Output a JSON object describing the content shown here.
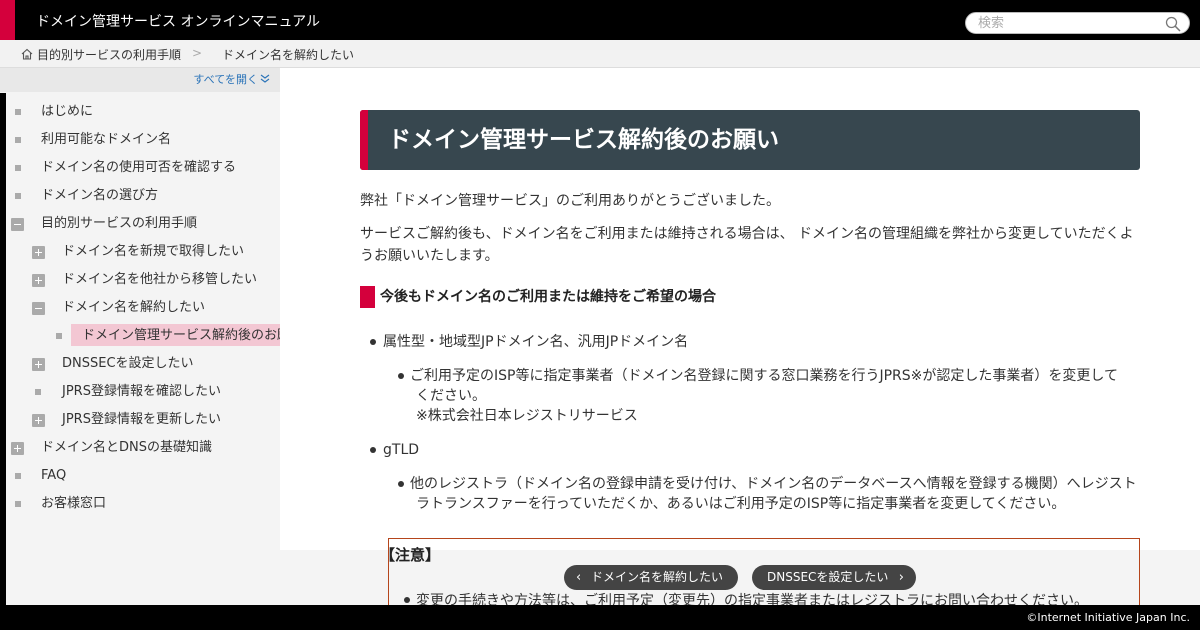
{
  "header": {
    "title": "ドメイン管理サービス オンラインマニュアル",
    "search_placeholder": "検索",
    "accent_color": "#d4003c"
  },
  "breadcrumb": {
    "items": [
      "目的別サービスの利用手順",
      "ドメイン名を解約したい"
    ],
    "separator": ">"
  },
  "sidebar": {
    "expand_all": "すべてを開く",
    "items": [
      {
        "label": "はじめに",
        "marker": "bullet"
      },
      {
        "label": "利用可能なドメイン名",
        "marker": "bullet"
      },
      {
        "label": "ドメイン名の使用可否を確認する",
        "marker": "bullet"
      },
      {
        "label": "ドメイン名の選び方",
        "marker": "bullet"
      },
      {
        "label": "目的別サービスの利用手順",
        "marker": "minus"
      },
      {
        "label": "ドメイン名を新規で取得したい",
        "marker": "plus"
      },
      {
        "label": "ドメイン名を他社から移管したい",
        "marker": "plus"
      },
      {
        "label": "ドメイン名を解約したい",
        "marker": "minus"
      },
      {
        "label": "ドメイン管理サービス解約後のお願い",
        "marker": "bullet",
        "active": true
      },
      {
        "label": "DNSSECを設定したい",
        "marker": "plus"
      },
      {
        "label": "JPRS登録情報を確認したい",
        "marker": "bullet"
      },
      {
        "label": "JPRS登録情報を更新したい",
        "marker": "plus"
      },
      {
        "label": "ドメイン名とDNSの基礎知識",
        "marker": "plus"
      },
      {
        "label": "FAQ",
        "marker": "bullet"
      },
      {
        "label": "お客様窓口",
        "marker": "bullet"
      }
    ]
  },
  "main": {
    "title": "ドメイン管理サービス解約後のお願い",
    "intro1": "弊社「ドメイン管理サービス」のご利用ありがとうございました。",
    "intro2_line1": "サービスご解約後も、ドメイン名をご利用または維持される場合は、 ドメイン名の管理組織を弊社から変更していただくよ",
    "intro2_line2": "うお願いいたします。",
    "section_heading": "今後もドメイン名のご利用または維持をご希望の場合",
    "list": [
      {
        "label": "属性型・地域型JPドメイン名、汎用JPドメイン名",
        "sub_lines": [
          "ご利用予定のISP等に指定事業者（ドメイン名登録に関する窓口業務を行うJPRS※が認定した事業者）を変更して",
          "ください。",
          "※株式会社日本レジストリサービス"
        ]
      },
      {
        "label": "gTLD",
        "sub_lines": [
          "他のレジストラ（ドメイン名の登録申請を受け付け、ドメイン名のデータベースへ情報を登録する機関）へレジスト",
          "ラトランスファーを行っていただくか、あるいはご利用予定のISP等に指定事業者を変更してください。"
        ]
      }
    ],
    "note_title": "【注意】",
    "note_item": "変更の手続きや方法等は、ご利用予定（変更先）の指定事業者またはレジストラにお問い合わせください。"
  },
  "pager": {
    "prev": "ドメイン名を解約したい",
    "next": "DNSSECを設定したい"
  },
  "footer": {
    "copyright": "©Internet Initiative Japan Inc."
  }
}
